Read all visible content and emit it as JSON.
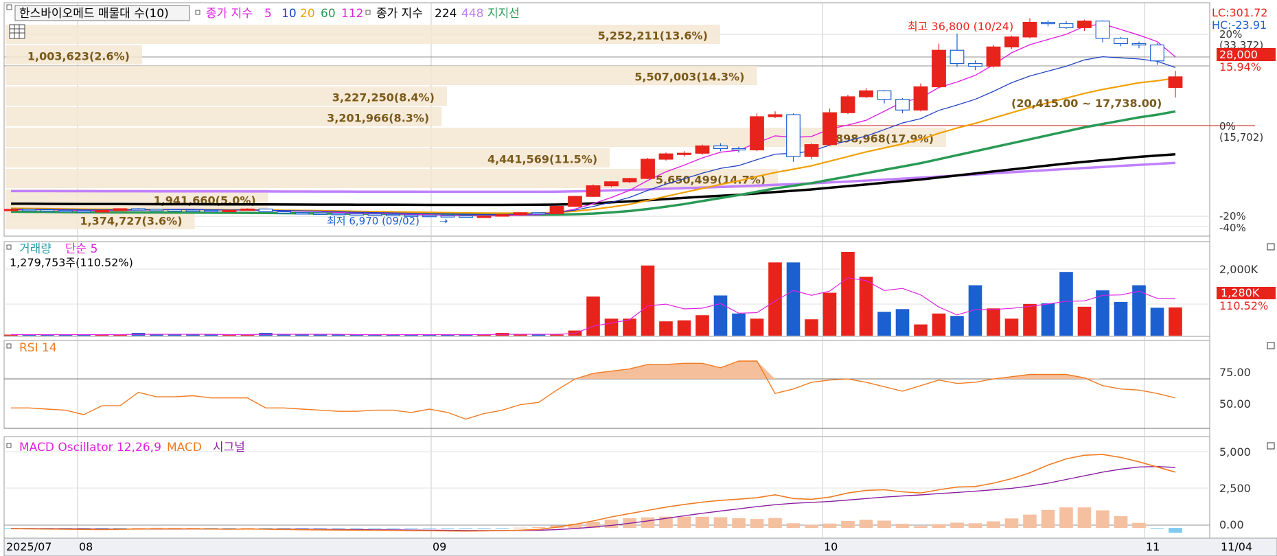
{
  "legend": {
    "main_title": "한스바이오메드 매물대 수(10)",
    "ma_label": "종가 지수",
    "ma_periods": [
      "5",
      "10",
      "20",
      "60",
      "112"
    ],
    "ma_label_2": "종가 지수",
    "ma_periods_2": [
      "224",
      "448"
    ],
    "support_label": "지지선",
    "volume_title": "거래량",
    "volume_ma": "단순 5",
    "volume_value": "1,279,753주(110.52%)",
    "rsi_title": "RSI 14",
    "macd_title": "MACD Oscillator 12,26,9",
    "macd_label": "MACD",
    "signal_label": "시그널"
  },
  "right_axis": {
    "lc": "LC:301.72",
    "hc": "HC:-23.91",
    "pct_20": "20%",
    "pct_20_value": "(33,372)",
    "last_price": "28,000",
    "last_pct": "15.94%",
    "zero": "0%",
    "zero_value": "(15,702)",
    "neg20": "-20%",
    "neg40": "-40%",
    "vol_tick": "2,000K",
    "vol_last": "1,280K",
    "vol_last_pct": "110.52%",
    "rsi_ticks": [
      "75.00",
      "50.00"
    ],
    "macd_ticks": [
      "5,000",
      "2,500",
      "0.00"
    ]
  },
  "annotations": {
    "high": "최고 36,800 (10/24)",
    "low": "최저 6,970 (09/02)",
    "range": "(20,415.00 ~ 17,738.00)"
  },
  "date_labels": [
    "2025/07",
    "08",
    "09",
    "10",
    "11",
    "11/04"
  ],
  "colors": {
    "up": "#e8231c",
    "down": "#1c5fd0",
    "ma5": "#e020e0",
    "ma10": "#2040c0",
    "ma20": "#f0a000",
    "ma60": "#2a9a55",
    "ma112": "#20a020",
    "ma224": "#000000",
    "ma448": "#c080ff",
    "profile": "#f5e6d2",
    "profile_text": "#7a5a1a",
    "rsi": "#f07a20",
    "rsi_fill": "#f5b890",
    "macd": "#f07a20",
    "signal": "#8a1fa0",
    "osc": "#f5c0a0",
    "osc_neg": "#7fc8f0"
  },
  "chart_data": [
    {
      "type": "candlestick",
      "title": "한스바이오메드",
      "high_label": "최고 36,800 (10/24)",
      "low_label": "최저 6,970 (09/02)",
      "last_close": 28000,
      "volume_profile": [
        {
          "label": "5,252,211(13.6%)",
          "pct": 13.6
        },
        {
          "label": "1,003,623(2.6%)",
          "pct": 2.6
        },
        {
          "label": "5,507,003(14.3%)",
          "pct": 14.3
        },
        {
          "label": "3,227,250(8.4%)",
          "pct": 8.4
        },
        {
          "label": "3,201,966(8.3%)",
          "pct": 8.3
        },
        {
          "label": "6,898,968(17.9%)",
          "pct": 17.9
        },
        {
          "label": "4,441,569(11.5%)",
          "pct": 11.5
        },
        {
          "label": "5,650,499(14.7%)",
          "pct": 14.7
        },
        {
          "label": "1,941,660(5.0%)",
          "pct": 5.0
        },
        {
          "label": "1,374,727(3.6%)",
          "pct": 3.6
        }
      ],
      "candles": [
        [
          8.0,
          8.1,
          7.9,
          8.05
        ],
        [
          8.05,
          8.1,
          7.95,
          7.98
        ],
        [
          7.98,
          8.0,
          7.85,
          7.9
        ],
        [
          7.9,
          7.95,
          7.8,
          7.85
        ],
        [
          7.85,
          7.9,
          7.6,
          7.65
        ],
        [
          7.65,
          7.9,
          7.6,
          7.88
        ],
        [
          7.88,
          8.2,
          7.85,
          8.15
        ],
        [
          8.15,
          8.25,
          8.0,
          8.05
        ],
        [
          8.05,
          8.1,
          7.95,
          8.0
        ],
        [
          8.0,
          8.05,
          7.9,
          7.95
        ],
        [
          7.95,
          8.0,
          7.85,
          7.9
        ],
        [
          7.9,
          7.95,
          7.8,
          7.85
        ],
        [
          7.85,
          7.95,
          7.8,
          7.9
        ],
        [
          7.9,
          8.2,
          7.85,
          8.1
        ],
        [
          8.1,
          8.15,
          7.6,
          7.7
        ],
        [
          7.7,
          7.75,
          7.5,
          7.55
        ],
        [
          7.55,
          7.6,
          7.45,
          7.5
        ],
        [
          7.5,
          7.55,
          7.4,
          7.45
        ],
        [
          7.45,
          7.5,
          7.35,
          7.4
        ],
        [
          7.4,
          7.45,
          7.3,
          7.35
        ],
        [
          7.35,
          7.4,
          7.25,
          7.3
        ],
        [
          7.3,
          7.35,
          7.15,
          7.2
        ],
        [
          7.2,
          7.3,
          7.1,
          7.15
        ],
        [
          7.15,
          7.2,
          7.05,
          7.1
        ],
        [
          7.1,
          7.2,
          7.0,
          7.05
        ],
        [
          7.05,
          7.1,
          6.97,
          7.0
        ],
        [
          7.0,
          7.05,
          6.97,
          7.02
        ],
        [
          7.02,
          7.3,
          7.0,
          7.25
        ],
        [
          7.25,
          7.6,
          7.2,
          7.55
        ],
        [
          7.55,
          7.6,
          7.35,
          7.4
        ],
        [
          7.4,
          8.6,
          7.35,
          8.5
        ],
        [
          8.5,
          10.1,
          8.4,
          10.0
        ],
        [
          10.0,
          11.8,
          9.9,
          11.6
        ],
        [
          11.6,
          12.3,
          11.4,
          12.2
        ],
        [
          12.2,
          12.8,
          12.0,
          12.7
        ],
        [
          12.7,
          15.8,
          12.6,
          15.6
        ],
        [
          15.6,
          16.6,
          15.4,
          16.4
        ],
        [
          16.4,
          16.8,
          16.0,
          16.5
        ],
        [
          16.5,
          17.8,
          16.3,
          17.6
        ],
        [
          17.6,
          18.0,
          16.8,
          17.2
        ],
        [
          17.2,
          17.5,
          16.6,
          17.0
        ],
        [
          17.0,
          22.5,
          16.8,
          22.0
        ],
        [
          22.0,
          22.8,
          21.8,
          22.3
        ],
        [
          22.3,
          22.5,
          15.2,
          16.0
        ],
        [
          16.0,
          18.0,
          15.6,
          17.8
        ],
        [
          17.8,
          23.2,
          17.6,
          22.6
        ],
        [
          22.6,
          25.3,
          22.4,
          25.0
        ],
        [
          25.0,
          26.3,
          24.8,
          25.9
        ],
        [
          25.9,
          26.0,
          24.0,
          24.6
        ],
        [
          24.6,
          24.8,
          22.5,
          23.0
        ],
        [
          23.0,
          27.0,
          22.8,
          26.5
        ],
        [
          26.5,
          33.0,
          26.3,
          32.0
        ],
        [
          32.0,
          34.5,
          29.5,
          30.0
        ],
        [
          30.0,
          30.5,
          29.0,
          29.6
        ],
        [
          29.6,
          32.8,
          29.4,
          32.5
        ],
        [
          32.5,
          34.2,
          32.2,
          34.0
        ],
        [
          34.0,
          36.8,
          33.8,
          36.2
        ],
        [
          36.2,
          36.5,
          35.6,
          36.0
        ],
        [
          36.0,
          36.4,
          35.2,
          35.4
        ],
        [
          35.4,
          36.6,
          34.9,
          36.4
        ],
        [
          36.4,
          36.5,
          33.2,
          33.8
        ],
        [
          33.8,
          34.0,
          32.6,
          33.0
        ],
        [
          33.0,
          33.3,
          32.3,
          32.8
        ],
        [
          32.8,
          33.1,
          29.8,
          30.4
        ],
        [
          26.4,
          28.9,
          24.9,
          28.0
        ]
      ],
      "moving_averages": {
        "ma5": [
          8.0,
          8.0,
          7.99,
          7.95,
          7.89,
          7.88,
          7.91,
          7.94,
          7.97,
          8.05,
          8.05,
          7.97,
          7.93,
          7.96,
          7.89,
          7.81,
          7.77,
          7.74,
          7.6,
          7.48,
          7.42,
          7.36,
          7.3,
          7.23,
          7.15,
          7.1,
          7.07,
          7.08,
          7.17,
          7.24,
          7.54,
          8.1,
          8.91,
          9.84,
          10.9,
          12.4,
          13.7,
          14.7,
          15.8,
          16.66,
          16.94,
          18.06,
          19.12,
          18.9,
          19.02,
          20.14,
          20.74,
          21.46,
          22.82,
          24.22,
          24.8,
          26.4,
          27.22,
          28.22,
          29.82,
          31.62,
          32.84,
          33.62,
          34.4,
          35.6,
          35.96,
          35.12,
          34.28,
          33.3,
          31.0
        ],
        "ma20": [
          8.2,
          8.18,
          8.15,
          8.12,
          8.08,
          8.06,
          8.05,
          8.04,
          8.03,
          8.02,
          8.01,
          8.0,
          7.99,
          7.98,
          7.95,
          7.92,
          7.88,
          7.85,
          7.8,
          7.76,
          7.72,
          7.68,
          7.64,
          7.6,
          7.56,
          7.52,
          7.49,
          7.48,
          7.48,
          7.5,
          7.6,
          7.78,
          8.05,
          8.4,
          8.8,
          9.4,
          10.0,
          10.6,
          11.2,
          11.8,
          12.35,
          13.0,
          13.6,
          14.1,
          14.6,
          15.3,
          16.0,
          16.7,
          17.3,
          17.9,
          18.6,
          19.5,
          20.3,
          21.0,
          21.8,
          22.6,
          23.4,
          24.1,
          24.8,
          25.5,
          26.1,
          26.6,
          27.1,
          27.4,
          27.8
        ],
        "ma60": [
          7.7,
          7.68,
          7.66,
          7.64,
          7.62,
          7.6,
          7.59,
          7.58,
          7.57,
          7.56,
          7.55,
          7.54,
          7.53,
          7.52,
          7.5,
          7.48,
          7.46,
          7.44,
          7.42,
          7.4,
          7.38,
          7.36,
          7.34,
          7.32,
          7.3,
          7.28,
          7.26,
          7.25,
          7.24,
          7.24,
          7.26,
          7.32,
          7.42,
          7.58,
          7.8,
          8.1,
          8.45,
          8.85,
          9.3,
          9.75,
          10.2,
          10.7,
          11.2,
          11.6,
          12.0,
          12.5,
          13.0,
          13.5,
          14.0,
          14.5,
          15.0,
          15.6,
          16.2,
          16.8,
          17.4,
          18.0,
          18.6,
          19.2,
          19.8,
          20.4,
          20.9,
          21.4,
          21.9,
          22.3,
          22.8
        ],
        "ma224": [
          8.9,
          8.9,
          8.88,
          8.87,
          8.86,
          8.85,
          8.85,
          8.84,
          8.83,
          8.82,
          8.82,
          8.81,
          8.8,
          8.8,
          8.79,
          8.78,
          8.77,
          8.76,
          8.76,
          8.75,
          8.74,
          8.74,
          8.73,
          8.72,
          8.72,
          8.72,
          8.72,
          8.72,
          8.73,
          8.74,
          8.77,
          8.84,
          8.95,
          9.1,
          9.25,
          9.42,
          9.6,
          9.78,
          9.95,
          10.1,
          10.25,
          10.45,
          10.65,
          10.85,
          11.05,
          11.3,
          11.55,
          11.8,
          12.05,
          12.3,
          12.55,
          12.85,
          13.15,
          13.45,
          13.75,
          14.05,
          14.35,
          14.65,
          14.95,
          15.2,
          15.45,
          15.7,
          15.95,
          16.15,
          16.35
        ],
        "ma448": [
          10.8,
          10.8,
          10.8,
          10.79,
          10.79,
          10.78,
          10.78,
          10.78,
          10.77,
          10.77,
          10.77,
          10.76,
          10.76,
          10.75,
          10.75,
          10.74,
          10.74,
          10.73,
          10.73,
          10.72,
          10.72,
          10.71,
          10.71,
          10.7,
          10.7,
          10.7,
          10.7,
          10.7,
          10.7,
          10.7,
          10.72,
          10.76,
          10.82,
          10.9,
          10.98,
          11.06,
          11.15,
          11.24,
          11.33,
          11.42,
          11.52,
          11.63,
          11.74,
          11.85,
          11.97,
          12.1,
          12.24,
          12.38,
          12.52,
          12.67,
          12.82,
          12.98,
          13.14,
          13.3,
          13.47,
          13.64,
          13.8,
          13.96,
          14.12,
          14.28,
          14.44,
          14.6,
          14.75,
          14.9,
          15.05
        ]
      }
    },
    {
      "type": "bar",
      "title": "거래량",
      "series": [
        {
          "name": "거래량",
          "values": [
            30,
            30,
            30,
            30,
            30,
            30,
            30,
            80,
            30,
            30,
            30,
            30,
            30,
            30,
            80,
            30,
            30,
            30,
            30,
            30,
            30,
            30,
            30,
            30,
            30,
            30,
            30,
            80,
            30,
            30,
            30,
            150,
            1150,
            500,
            500,
            2060,
            420,
            450,
            600,
            1180,
            650,
            500,
            2150,
            2150,
            480,
            1260,
            2460,
            1730,
            700,
            780,
            330,
            650,
            580,
            1480,
            800,
            500,
            930,
            950,
            1870,
            850,
            1330,
            990,
            1480,
            820,
            830,
            1100,
            1280
          ]
        }
      ],
      "ylim": [
        0,
        2600
      ]
    },
    {
      "type": "line",
      "title": "RSI 14",
      "series": [
        {
          "name": "RSI 14",
          "values": [
            42,
            42,
            41,
            40,
            36,
            44,
            44,
            56,
            52,
            52,
            53,
            51,
            51,
            51,
            42,
            42,
            41,
            40,
            39,
            39,
            40,
            40,
            38,
            41,
            38,
            32,
            37,
            40,
            45,
            47,
            58,
            68,
            73,
            75,
            77,
            81,
            81,
            82,
            82,
            78,
            84,
            84,
            55,
            59,
            65,
            67,
            68,
            65,
            61,
            57,
            62,
            67,
            64,
            65,
            68,
            70,
            72,
            72,
            72,
            69,
            62,
            59,
            58,
            55,
            51,
            57
          ]
        }
      ],
      "ylim": [
        25,
        100
      ]
    },
    {
      "type": "line",
      "title": "MACD Oscillator 12,26,9",
      "series": [
        {
          "name": "MACD",
          "values": [
            -50,
            -60,
            -70,
            -80,
            -100,
            -110,
            -90,
            -70,
            -60,
            -60,
            -60,
            -70,
            -80,
            -70,
            -80,
            -100,
            -120,
            -130,
            -140,
            -150,
            -160,
            -170,
            -180,
            -190,
            -200,
            -210,
            -200,
            -180,
            -150,
            -100,
            50,
            250,
            480,
            750,
            980,
            1200,
            1420,
            1600,
            1760,
            1880,
            1960,
            2060,
            2260,
            2000,
            1950,
            2100,
            2380,
            2560,
            2600,
            2460,
            2380,
            2600,
            2780,
            2820,
            3050,
            3350,
            3760,
            4280,
            4700,
            4950,
            5000,
            4800,
            4500,
            4150,
            3800,
            3300,
            3100
          ]
        },
        {
          "name": "시그널",
          "values": [
            -40,
            -45,
            -50,
            -55,
            -62,
            -70,
            -74,
            -74,
            -72,
            -70,
            -68,
            -68,
            -70,
            -70,
            -72,
            -78,
            -86,
            -95,
            -104,
            -113,
            -122,
            -132,
            -141,
            -151,
            -161,
            -171,
            -177,
            -178,
            -172,
            -157,
            -115,
            -40,
            60,
            175,
            320,
            480,
            650,
            830,
            1000,
            1150,
            1300,
            1450,
            1580,
            1680,
            1740,
            1800,
            1900,
            2000,
            2100,
            2180,
            2250,
            2340,
            2420,
            2500,
            2600,
            2700,
            2850,
            3050,
            3300,
            3550,
            3800,
            4000,
            4150,
            4180,
            4120,
            3950,
            3750
          ]
        }
      ],
      "ylim": [
        -600,
        5800
      ]
    }
  ]
}
